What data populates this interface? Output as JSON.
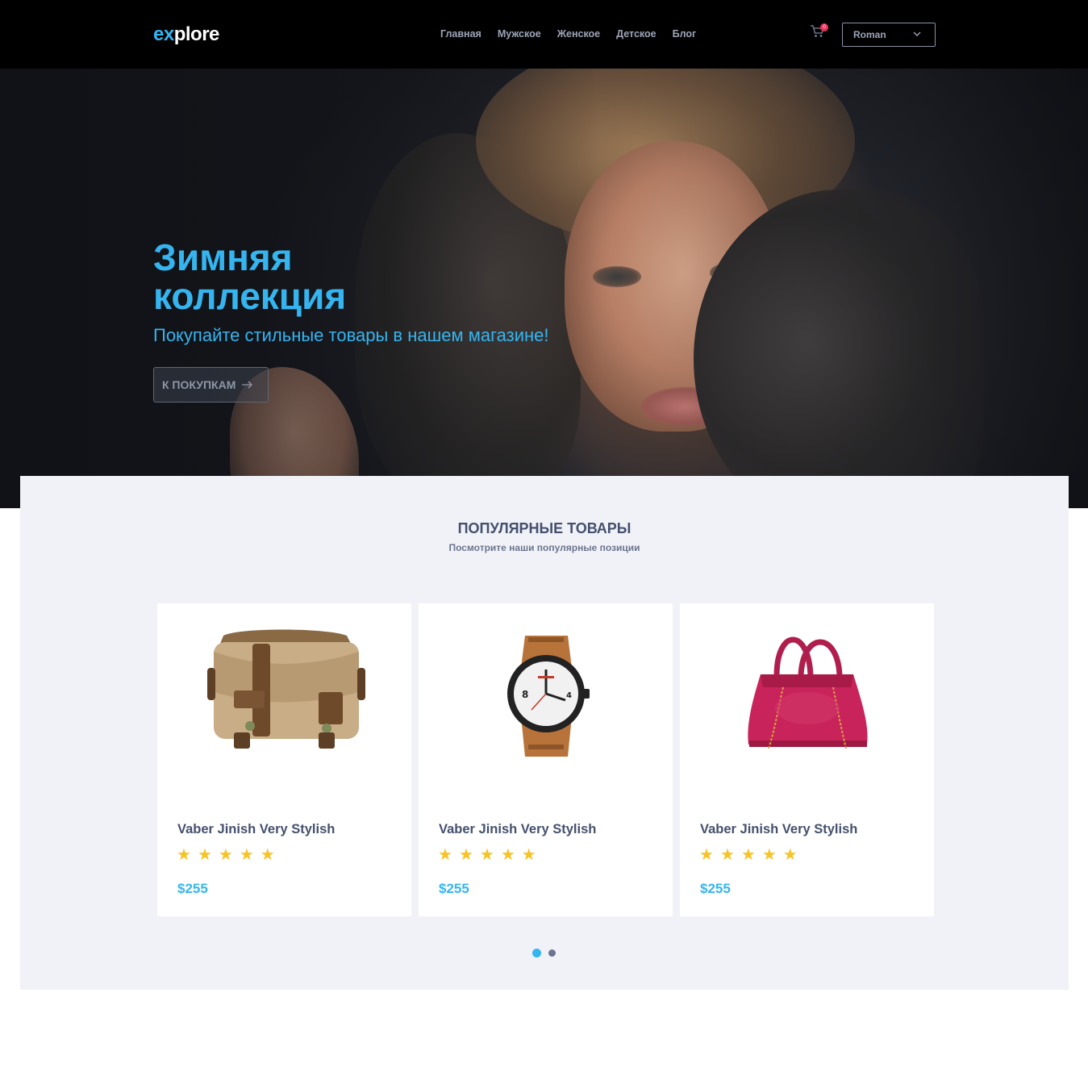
{
  "header": {
    "logo_prefix": "ex",
    "logo_suffix": "plore",
    "nav": [
      "Главная",
      "Мужское",
      "Женское",
      "Детское",
      "Блог"
    ],
    "cart_count": "0",
    "user_select_value": "Roman"
  },
  "hero": {
    "title": "Зимняя коллекция",
    "subtitle": "Покупайте стильные товары в нашем магазине!",
    "button_label": "К ПОКУПКАМ"
  },
  "popular": {
    "title": "ПОПУЛЯРНЫЕ ТОВАРЫ",
    "subtitle": "Посмотрите наши популярные позиции",
    "products": [
      {
        "name": "Vaber Jinish Very Stylish",
        "rating": 5,
        "price": "$255",
        "image": "canvas-messenger-bag"
      },
      {
        "name": "Vaber Jinish Very Stylish",
        "rating": 5,
        "price": "$255",
        "image": "leather-wristwatch"
      },
      {
        "name": "Vaber Jinish Very Stylish",
        "rating": 5,
        "price": "$255",
        "image": "pink-handbag"
      }
    ],
    "carousel_pages": 2,
    "carousel_active": 1
  },
  "colors": {
    "accent": "#35b5f0",
    "header_bg": "#000000",
    "section_bg": "#f0f2f7",
    "star": "#f7c325",
    "badge": "#e8335b",
    "heading": "#44506e"
  }
}
